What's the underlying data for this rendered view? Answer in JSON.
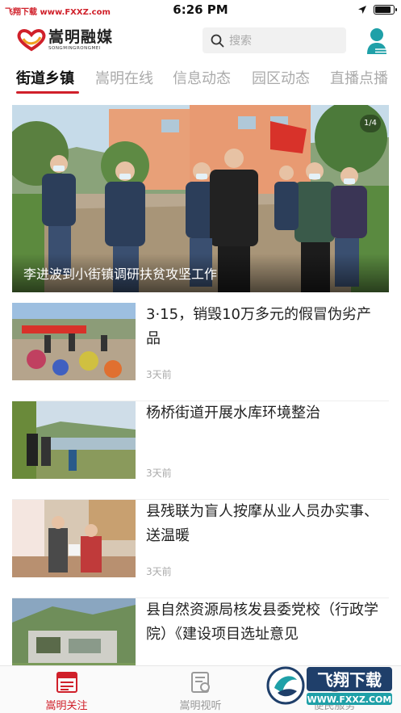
{
  "status_bar": {
    "watermark_left": "飞翔下载 www.FXXZ.com",
    "time": "6:26 PM",
    "battery_level": 0.9
  },
  "header": {
    "logo_text": "嵩明融媒",
    "logo_subtext": "SONGMINGRONGMEI",
    "search_placeholder": "搜索",
    "icons": [
      "search-icon",
      "user-icon"
    ]
  },
  "tabs": [
    {
      "label": "街道乡镇",
      "active": true
    },
    {
      "label": "嵩明在线",
      "active": false
    },
    {
      "label": "信息动态",
      "active": false
    },
    {
      "label": "园区动态",
      "active": false
    },
    {
      "label": "直播点播",
      "active": false
    }
  ],
  "hero": {
    "counter": "1/4",
    "title": "李进波到小街镇调研扶贫攻坚工作"
  },
  "news": [
    {
      "title": "3·15，销毁10万多元的假冒伪劣产品",
      "time": "3天前"
    },
    {
      "title": "杨桥街道开展水库环境整治",
      "time": "3天前"
    },
    {
      "title": "县残联为盲人按摩从业人员办实事、送温暖",
      "time": "3天前"
    },
    {
      "title": "县自然资源局核发县委党校（行政学院）《建设项目选址意见",
      "time": ""
    }
  ],
  "bottom_nav": [
    {
      "label": "嵩明关注",
      "icon": "news-icon",
      "active": true
    },
    {
      "label": "嵩明视听",
      "icon": "audio-video-icon",
      "active": false
    },
    {
      "label": "便民服务",
      "icon": "service-icon",
      "active": false
    }
  ],
  "watermark": {
    "text_cn": "飞翔下载",
    "text_en": "WWW.FXXZ.COM"
  },
  "colors": {
    "accent": "#d0202a",
    "teal": "#1fa0a8",
    "inactive": "#aaaaaa"
  }
}
